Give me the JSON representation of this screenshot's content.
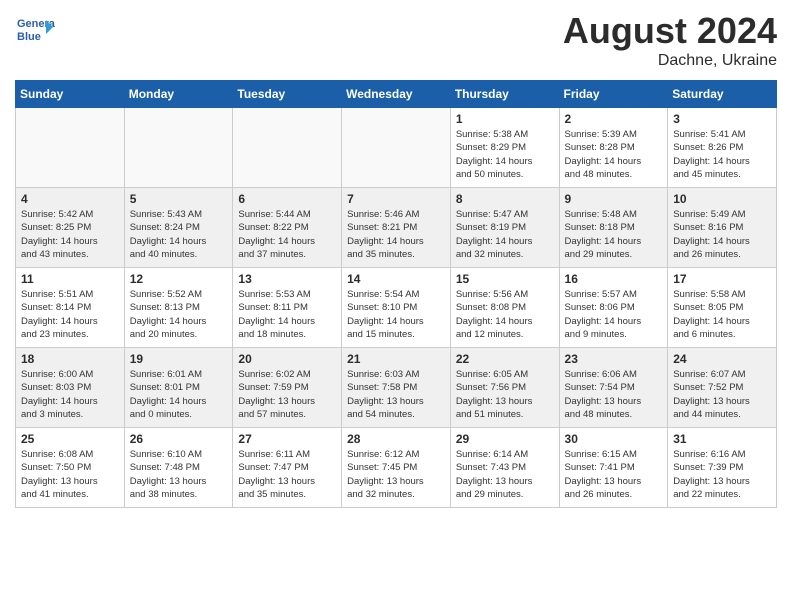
{
  "header": {
    "logo_line1": "General",
    "logo_line2": "Blue",
    "month_title": "August 2024",
    "location": "Dachne, Ukraine"
  },
  "days_of_week": [
    "Sunday",
    "Monday",
    "Tuesday",
    "Wednesday",
    "Thursday",
    "Friday",
    "Saturday"
  ],
  "weeks": [
    [
      {
        "day": "",
        "info": ""
      },
      {
        "day": "",
        "info": ""
      },
      {
        "day": "",
        "info": ""
      },
      {
        "day": "",
        "info": ""
      },
      {
        "day": "1",
        "info": "Sunrise: 5:38 AM\nSunset: 8:29 PM\nDaylight: 14 hours\nand 50 minutes."
      },
      {
        "day": "2",
        "info": "Sunrise: 5:39 AM\nSunset: 8:28 PM\nDaylight: 14 hours\nand 48 minutes."
      },
      {
        "day": "3",
        "info": "Sunrise: 5:41 AM\nSunset: 8:26 PM\nDaylight: 14 hours\nand 45 minutes."
      }
    ],
    [
      {
        "day": "4",
        "info": "Sunrise: 5:42 AM\nSunset: 8:25 PM\nDaylight: 14 hours\nand 43 minutes."
      },
      {
        "day": "5",
        "info": "Sunrise: 5:43 AM\nSunset: 8:24 PM\nDaylight: 14 hours\nand 40 minutes."
      },
      {
        "day": "6",
        "info": "Sunrise: 5:44 AM\nSunset: 8:22 PM\nDaylight: 14 hours\nand 37 minutes."
      },
      {
        "day": "7",
        "info": "Sunrise: 5:46 AM\nSunset: 8:21 PM\nDaylight: 14 hours\nand 35 minutes."
      },
      {
        "day": "8",
        "info": "Sunrise: 5:47 AM\nSunset: 8:19 PM\nDaylight: 14 hours\nand 32 minutes."
      },
      {
        "day": "9",
        "info": "Sunrise: 5:48 AM\nSunset: 8:18 PM\nDaylight: 14 hours\nand 29 minutes."
      },
      {
        "day": "10",
        "info": "Sunrise: 5:49 AM\nSunset: 8:16 PM\nDaylight: 14 hours\nand 26 minutes."
      }
    ],
    [
      {
        "day": "11",
        "info": "Sunrise: 5:51 AM\nSunset: 8:14 PM\nDaylight: 14 hours\nand 23 minutes."
      },
      {
        "day": "12",
        "info": "Sunrise: 5:52 AM\nSunset: 8:13 PM\nDaylight: 14 hours\nand 20 minutes."
      },
      {
        "day": "13",
        "info": "Sunrise: 5:53 AM\nSunset: 8:11 PM\nDaylight: 14 hours\nand 18 minutes."
      },
      {
        "day": "14",
        "info": "Sunrise: 5:54 AM\nSunset: 8:10 PM\nDaylight: 14 hours\nand 15 minutes."
      },
      {
        "day": "15",
        "info": "Sunrise: 5:56 AM\nSunset: 8:08 PM\nDaylight: 14 hours\nand 12 minutes."
      },
      {
        "day": "16",
        "info": "Sunrise: 5:57 AM\nSunset: 8:06 PM\nDaylight: 14 hours\nand 9 minutes."
      },
      {
        "day": "17",
        "info": "Sunrise: 5:58 AM\nSunset: 8:05 PM\nDaylight: 14 hours\nand 6 minutes."
      }
    ],
    [
      {
        "day": "18",
        "info": "Sunrise: 6:00 AM\nSunset: 8:03 PM\nDaylight: 14 hours\nand 3 minutes."
      },
      {
        "day": "19",
        "info": "Sunrise: 6:01 AM\nSunset: 8:01 PM\nDaylight: 14 hours\nand 0 minutes."
      },
      {
        "day": "20",
        "info": "Sunrise: 6:02 AM\nSunset: 7:59 PM\nDaylight: 13 hours\nand 57 minutes."
      },
      {
        "day": "21",
        "info": "Sunrise: 6:03 AM\nSunset: 7:58 PM\nDaylight: 13 hours\nand 54 minutes."
      },
      {
        "day": "22",
        "info": "Sunrise: 6:05 AM\nSunset: 7:56 PM\nDaylight: 13 hours\nand 51 minutes."
      },
      {
        "day": "23",
        "info": "Sunrise: 6:06 AM\nSunset: 7:54 PM\nDaylight: 13 hours\nand 48 minutes."
      },
      {
        "day": "24",
        "info": "Sunrise: 6:07 AM\nSunset: 7:52 PM\nDaylight: 13 hours\nand 44 minutes."
      }
    ],
    [
      {
        "day": "25",
        "info": "Sunrise: 6:08 AM\nSunset: 7:50 PM\nDaylight: 13 hours\nand 41 minutes."
      },
      {
        "day": "26",
        "info": "Sunrise: 6:10 AM\nSunset: 7:48 PM\nDaylight: 13 hours\nand 38 minutes."
      },
      {
        "day": "27",
        "info": "Sunrise: 6:11 AM\nSunset: 7:47 PM\nDaylight: 13 hours\nand 35 minutes."
      },
      {
        "day": "28",
        "info": "Sunrise: 6:12 AM\nSunset: 7:45 PM\nDaylight: 13 hours\nand 32 minutes."
      },
      {
        "day": "29",
        "info": "Sunrise: 6:14 AM\nSunset: 7:43 PM\nDaylight: 13 hours\nand 29 minutes."
      },
      {
        "day": "30",
        "info": "Sunrise: 6:15 AM\nSunset: 7:41 PM\nDaylight: 13 hours\nand 26 minutes."
      },
      {
        "day": "31",
        "info": "Sunrise: 6:16 AM\nSunset: 7:39 PM\nDaylight: 13 hours\nand 22 minutes."
      }
    ]
  ]
}
